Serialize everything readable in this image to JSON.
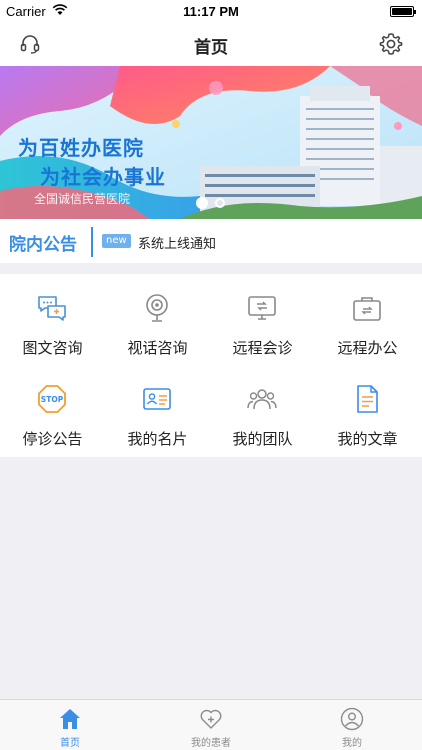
{
  "status_bar": {
    "carrier": "Carrier",
    "time": "11:17 PM"
  },
  "nav": {
    "title": "首页",
    "left_icon": "headset-icon",
    "right_icon": "gear-icon"
  },
  "banner": {
    "line1": "为百姓办医院",
    "line2": "为社会办事业",
    "line3": "全国诚信民营医院",
    "slide_count": 2,
    "active_slide": 1
  },
  "notice": {
    "label": "院内公告",
    "badge": "new",
    "text": "系统上线通知"
  },
  "menu": [
    {
      "label": "图文咨询",
      "icon": "chat-bubbles-icon"
    },
    {
      "label": "视话咨询",
      "icon": "webcam-icon"
    },
    {
      "label": "远程会诊",
      "icon": "monitor-transfer-icon"
    },
    {
      "label": "远程办公",
      "icon": "briefcase-icon"
    },
    {
      "label": "停诊公告",
      "icon": "stop-sign-icon"
    },
    {
      "label": "我的名片",
      "icon": "id-card-icon"
    },
    {
      "label": "我的团队",
      "icon": "team-icon"
    },
    {
      "label": "我的文章",
      "icon": "document-icon"
    }
  ],
  "tabs": [
    {
      "label": "首页",
      "icon": "home-icon",
      "active": true
    },
    {
      "label": "我的患者",
      "icon": "heart-plus-icon",
      "active": false
    },
    {
      "label": "我的",
      "icon": "user-circle-icon",
      "active": false
    }
  ],
  "colors": {
    "accent": "#3a8ee6",
    "tab_inactive": "#8c8c8c",
    "background": "#efeff4"
  }
}
